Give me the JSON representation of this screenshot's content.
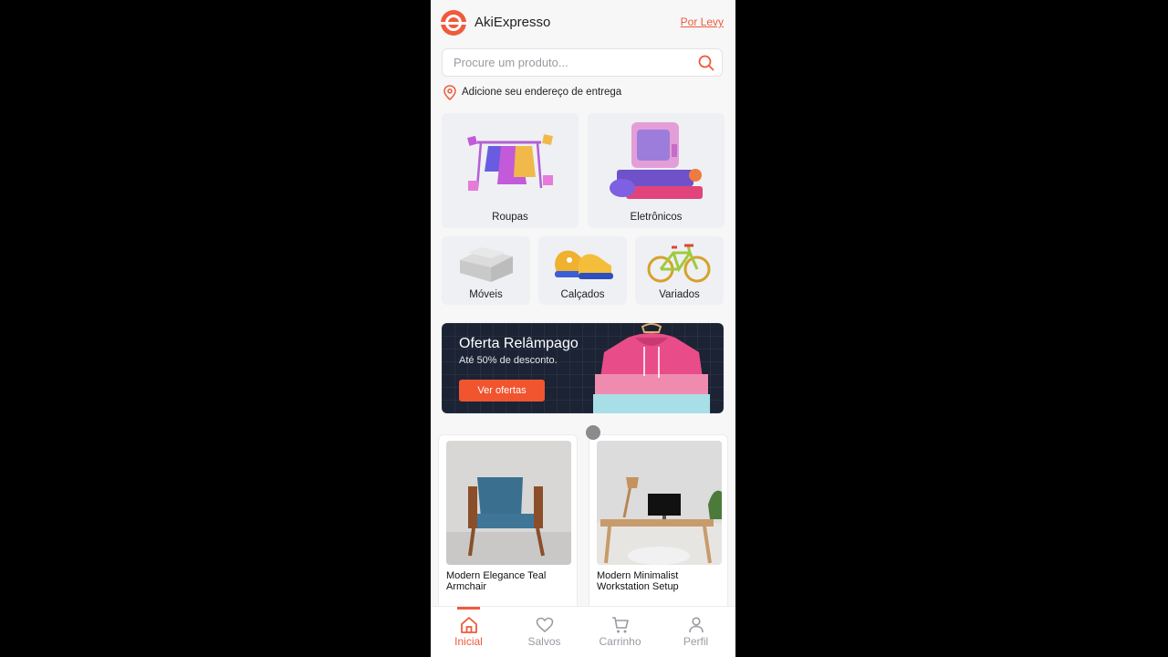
{
  "app": {
    "brand": "AkiExpresso",
    "byline": "Por Levy",
    "accent_color": "#f05a3c"
  },
  "search": {
    "placeholder": "Procure um produto...",
    "value": "",
    "icon": "search-icon"
  },
  "address": {
    "label": "Adicione seu endereço de entrega",
    "icon": "location-pin-icon"
  },
  "categories": [
    {
      "label": "Roupas"
    },
    {
      "label": "Eletrônicos"
    },
    {
      "label": "Móveis"
    },
    {
      "label": "Calçados"
    },
    {
      "label": "Variados"
    }
  ],
  "banner": {
    "title": "Oferta Relâmpago",
    "subtitle": "Até 50% de desconto.",
    "button": "Ver ofertas"
  },
  "products": [
    {
      "name": "Modern Elegance Teal Armchair"
    },
    {
      "name": "Modern Minimalist Workstation Setup"
    }
  ],
  "nav": [
    {
      "label": "Inicial",
      "icon": "home-icon",
      "active": true
    },
    {
      "label": "Salvos",
      "icon": "heart-icon",
      "active": false
    },
    {
      "label": "Carrinho",
      "icon": "cart-icon",
      "active": false
    },
    {
      "label": "Perfil",
      "icon": "user-icon",
      "active": false
    }
  ]
}
